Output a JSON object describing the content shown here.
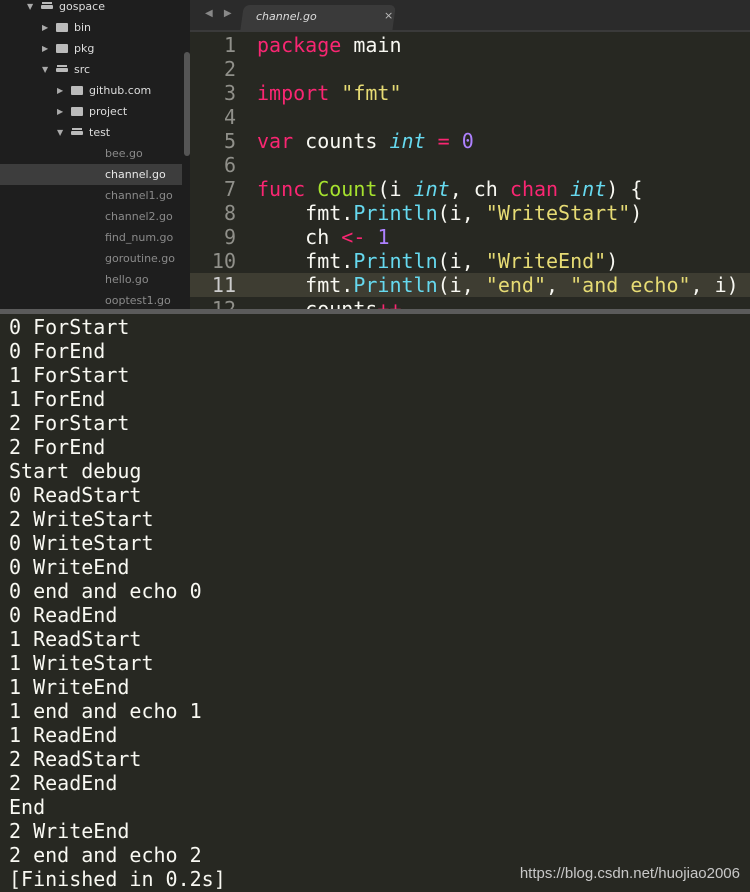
{
  "sidebar": {
    "items": [
      {
        "label": "gospace",
        "kind": "folder-open",
        "depth": 0
      },
      {
        "label": "bin",
        "kind": "folder",
        "depth": 1
      },
      {
        "label": "pkg",
        "kind": "folder",
        "depth": 1
      },
      {
        "label": "src",
        "kind": "folder-open",
        "depth": 1
      },
      {
        "label": "github.com",
        "kind": "folder",
        "depth": 2
      },
      {
        "label": "project",
        "kind": "folder",
        "depth": 2
      },
      {
        "label": "test",
        "kind": "folder-open",
        "depth": 2
      },
      {
        "label": "bee.go",
        "kind": "file",
        "depth": 3
      },
      {
        "label": "channel.go",
        "kind": "file",
        "depth": 3,
        "selected": true
      },
      {
        "label": "channel1.go",
        "kind": "file",
        "depth": 3
      },
      {
        "label": "channel2.go",
        "kind": "file",
        "depth": 3
      },
      {
        "label": "find_num.go",
        "kind": "file",
        "depth": 3
      },
      {
        "label": "goroutine.go",
        "kind": "file",
        "depth": 3
      },
      {
        "label": "hello.go",
        "kind": "file",
        "depth": 3
      },
      {
        "label": "ooptest1.go",
        "kind": "file",
        "depth": 3
      }
    ]
  },
  "tabbar": {
    "nav": "◀ ▶",
    "tab_label": "channel.go",
    "close": "×"
  },
  "editor": {
    "current_line": 11,
    "lines": [
      [
        [
          "package",
          "kw"
        ],
        [
          " main",
          ""
        ]
      ],
      [],
      [
        [
          "import",
          "kw"
        ],
        [
          " ",
          ""
        ],
        [
          "\"fmt\"",
          "st"
        ]
      ],
      [],
      [
        [
          "var",
          "kw"
        ],
        [
          " counts ",
          ""
        ],
        [
          "int",
          "ty"
        ],
        [
          " ",
          ""
        ],
        [
          "=",
          "op"
        ],
        [
          " ",
          ""
        ],
        [
          "0",
          "nu"
        ]
      ],
      [],
      [
        [
          "func",
          "kw"
        ],
        [
          " ",
          ""
        ],
        [
          "Count",
          "fn"
        ],
        [
          "(i ",
          ""
        ],
        [
          "int",
          "ty"
        ],
        [
          ", ch ",
          ""
        ],
        [
          "chan",
          "kw"
        ],
        [
          " ",
          ""
        ],
        [
          "int",
          "ty"
        ],
        [
          ") {",
          ""
        ]
      ],
      [
        [
          "    fmt.",
          ""
        ],
        [
          "Println",
          "me"
        ],
        [
          "(i, ",
          ""
        ],
        [
          "\"WriteStart\"",
          "st"
        ],
        [
          ")",
          ""
        ]
      ],
      [
        [
          "    ch ",
          ""
        ],
        [
          "<-",
          "op"
        ],
        [
          " ",
          ""
        ],
        [
          "1",
          "nu"
        ]
      ],
      [
        [
          "    fmt.",
          ""
        ],
        [
          "Println",
          "me"
        ],
        [
          "(i, ",
          ""
        ],
        [
          "\"WriteEnd\"",
          "st"
        ],
        [
          ")",
          ""
        ]
      ],
      [
        [
          "    fmt.",
          ""
        ],
        [
          "Println",
          "me"
        ],
        [
          "(i, ",
          ""
        ],
        [
          "\"end\"",
          "st"
        ],
        [
          ", ",
          ""
        ],
        [
          "\"and echo\"",
          "st"
        ],
        [
          ", i)",
          ""
        ]
      ],
      [
        [
          "    counts",
          ""
        ],
        [
          "++",
          "op"
        ]
      ]
    ]
  },
  "output": {
    "lines": [
      "0 ForStart",
      "0 ForEnd",
      "1 ForStart",
      "1 ForEnd",
      "2 ForStart",
      "2 ForEnd",
      "Start debug",
      "0 ReadStart",
      "2 WriteStart",
      "0 WriteStart",
      "0 WriteEnd",
      "0 end and echo 0",
      "0 ReadEnd",
      "1 ReadStart",
      "1 WriteStart",
      "1 WriteEnd",
      "1 end and echo 1",
      "1 ReadEnd",
      "2 ReadStart",
      "2 ReadEnd",
      "End",
      "2 WriteEnd",
      "2 end and echo 2",
      "[Finished in 0.2s]"
    ]
  },
  "watermark": "https://blog.csdn.net/huojiao2006"
}
